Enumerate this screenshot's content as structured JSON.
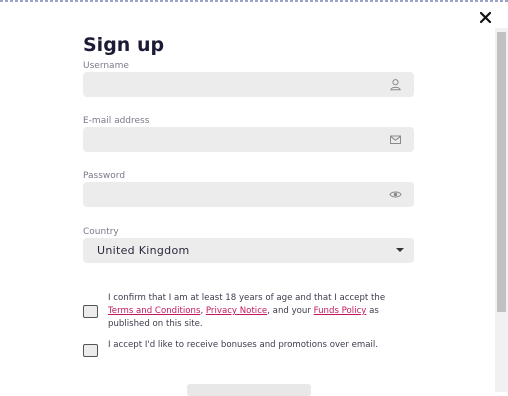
{
  "title": "Sign up",
  "fields": {
    "username": {
      "label": "Username",
      "value": "",
      "icon": "user-icon"
    },
    "email": {
      "label": "E-mail address",
      "value": "",
      "icon": "mail-icon"
    },
    "password": {
      "label": "Password",
      "value": "",
      "icon": "eye-icon"
    },
    "country": {
      "label": "Country",
      "value": "United Kingdom",
      "icon": "chevron-down-icon"
    }
  },
  "consent": {
    "part1": "I confirm that I am at least 18 years of age and that I accept the ",
    "terms_link": "Terms and Conditions",
    "sep1": ", ",
    "privacy_link": "Privacy Notice",
    "sep2": ", and your ",
    "funds_link": "Funds Policy",
    "part2": " as published on this site."
  },
  "bonus": {
    "text": "I accept I'd like to receive bonuses and promotions over email."
  },
  "colors": {
    "link": "#c2185b",
    "field_bg": "#ececec"
  }
}
